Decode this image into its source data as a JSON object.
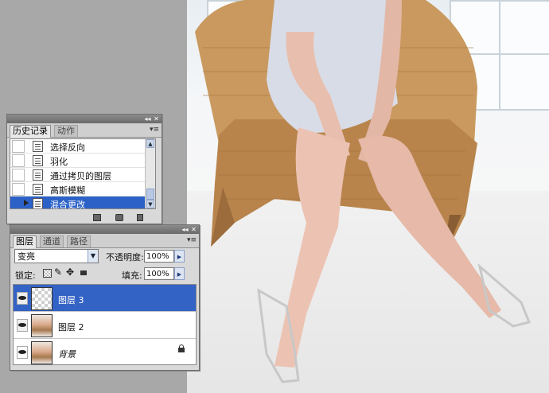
{
  "history_panel": {
    "tabs": [
      "历史记录",
      "动作"
    ],
    "items": [
      "选择反向",
      "羽化",
      "通过拷贝的图层",
      "高斯模糊",
      "混合更改"
    ],
    "selected_index": 4
  },
  "layers_panel": {
    "tabs": [
      "图层",
      "通道",
      "路径"
    ],
    "blend_mode": "变亮",
    "opacity_label": "不透明度:",
    "opacity_value": "100%",
    "lock_label": "锁定:",
    "fill_label": "填充:",
    "fill_value": "100%",
    "layers": [
      {
        "name": "图层 3",
        "visible": true,
        "selected": true
      },
      {
        "name": "图层 2",
        "visible": true,
        "selected": false
      },
      {
        "name": "背景",
        "visible": false,
        "selected": false,
        "locked": true
      }
    ]
  },
  "colors": {
    "selection": "#2c62c8",
    "panel_bg": "#d9d9d9",
    "workspace": "#a8a8a8"
  }
}
